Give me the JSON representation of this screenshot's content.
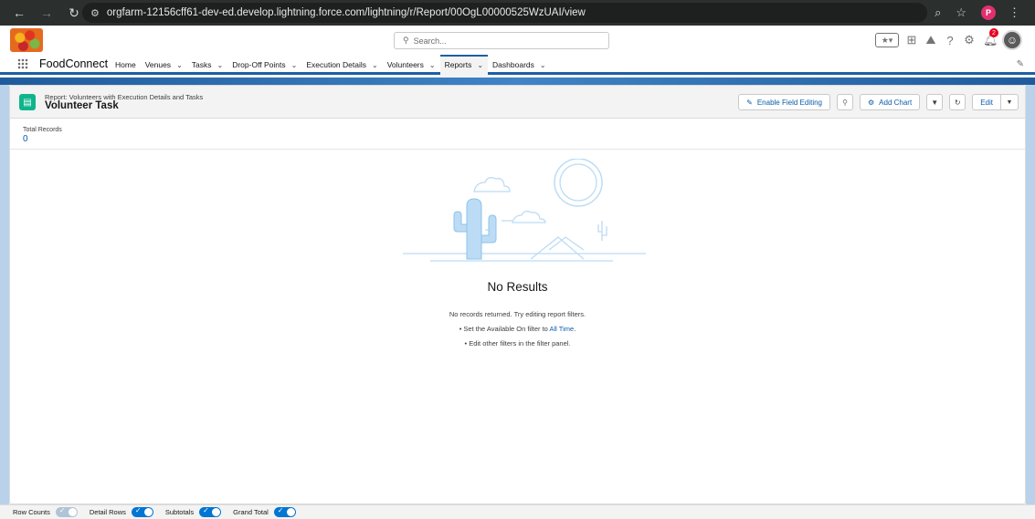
{
  "browser": {
    "url": "orgfarm-12156cff61-dev-ed.develop.lightning.force.com/lightning/r/Report/00OgL00000525WzUAI/view",
    "profile_initial": "P"
  },
  "header": {
    "search_placeholder": "Search...",
    "notification_count": "2"
  },
  "app": {
    "name": "FoodConnect",
    "tabs": [
      {
        "label": "Home",
        "has_menu": false
      },
      {
        "label": "Venues",
        "has_menu": true
      },
      {
        "label": "Tasks",
        "has_menu": true
      },
      {
        "label": "Drop-Off Points",
        "has_menu": true
      },
      {
        "label": "Execution Details",
        "has_menu": true
      },
      {
        "label": "Volunteers",
        "has_menu": true
      },
      {
        "label": "Reports",
        "has_menu": true,
        "active": true
      },
      {
        "label": "Dashboards",
        "has_menu": true
      }
    ]
  },
  "report": {
    "subtitle": "Report: Volunteers with Execution Details and Tasks",
    "title": "Volunteer Task",
    "buttons": {
      "enable_field_editing": "Enable Field Editing",
      "add_chart": "Add Chart",
      "edit": "Edit"
    },
    "total_records_label": "Total Records",
    "total_records_value": "0"
  },
  "empty_state": {
    "heading": "No Results",
    "line1": "No records returned. Try editing report filters.",
    "line2_prefix": "• Set the Available On filter to ",
    "line2_link": "All Time",
    "line2_suffix": ".",
    "line3": "• Edit other filters in the filter panel."
  },
  "footer": {
    "row_counts": "Row Counts",
    "detail_rows": "Detail Rows",
    "subtotals": "Subtotals",
    "grand_total": "Grand Total",
    "toggles": {
      "row_counts": false,
      "detail_rows": true,
      "subtotals": true,
      "grand_total": true
    }
  },
  "colors": {
    "brand_blue": "#0176d3",
    "link_blue": "#0b5cab",
    "report_icon": "#0eb58a",
    "illustration": "#bcdcf5"
  }
}
